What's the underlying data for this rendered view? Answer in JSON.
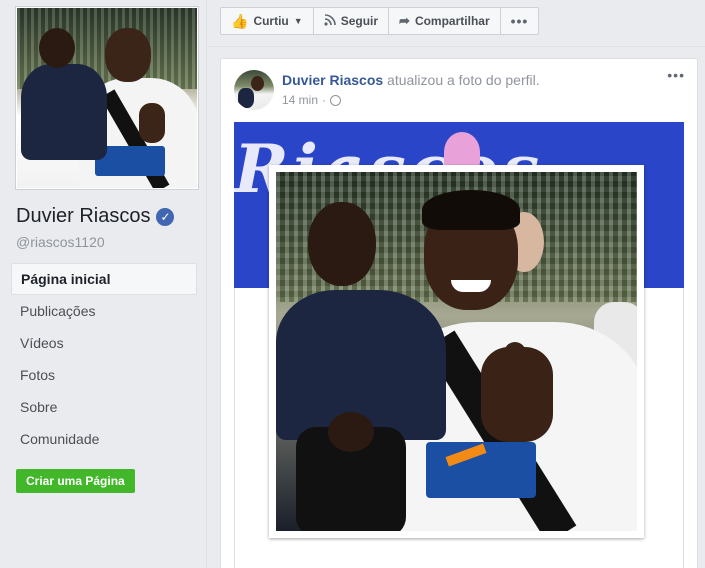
{
  "sidebar": {
    "page_name": "Duvier Riascos",
    "verified_icon": "verified-badge-icon",
    "handle": "@riascos1120",
    "nav": [
      {
        "label": "Página inicial",
        "active": true
      },
      {
        "label": "Publicações",
        "active": false
      },
      {
        "label": "Vídeos",
        "active": false
      },
      {
        "label": "Fotos",
        "active": false
      },
      {
        "label": "Sobre",
        "active": false
      },
      {
        "label": "Comunidade",
        "active": false
      }
    ],
    "create_page_label": "Criar uma Página"
  },
  "actions": {
    "liked_label": "Curtiu",
    "follow_label": "Seguir",
    "share_label": "Compartilhar",
    "more_label": "•••"
  },
  "post": {
    "author": "Duvier Riascos",
    "action_text": " atualizou a foto do perfil.",
    "time": "14 min",
    "separator": "·",
    "options_label": "•••",
    "cover_text": "Riascos"
  },
  "colors": {
    "brand_blue": "#4267b2",
    "link_blue": "#365899",
    "green": "#42b72a",
    "cover_blue": "#2b45c8"
  }
}
